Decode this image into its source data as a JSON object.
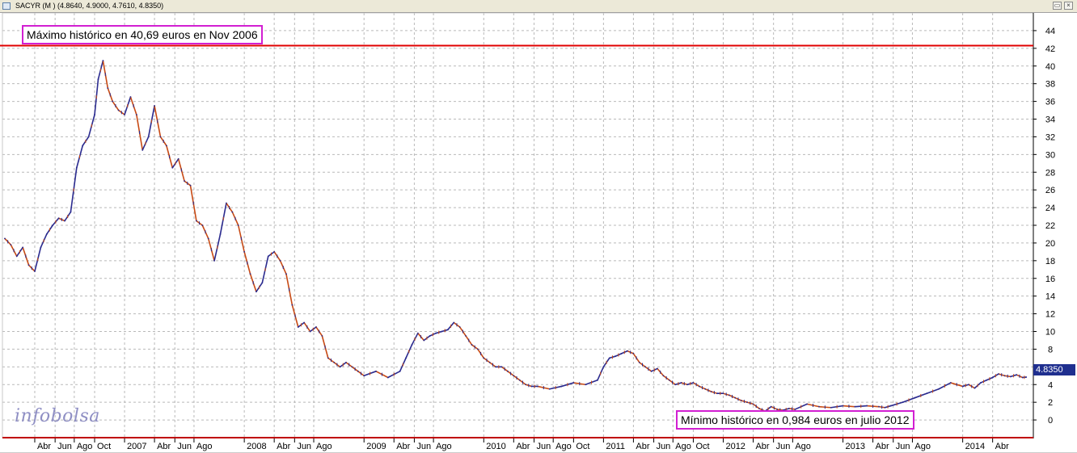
{
  "window": {
    "title": "SACYR (M ) (4.8640, 4.9000, 4.7610, 4.8350)"
  },
  "annotations": {
    "max_label": "Máximo histórico en 40,69 euros en Nov 2006",
    "min_label": "Mínimo histórico en 0,984 euros en julio 2012"
  },
  "logo": {
    "text_part1": "info",
    "text_part2": "bolsa"
  },
  "last_price": "4.8350",
  "colors": {
    "up": "#2b2b8f",
    "down": "#c84a14",
    "resistance": "#e00000",
    "annotation_border": "#d21fd2",
    "grid": "#b9b9b9"
  },
  "chart_data": {
    "type": "line",
    "ylim": [
      -2,
      46
    ],
    "yticks": [
      0,
      2,
      4,
      6,
      8,
      10,
      12,
      14,
      16,
      18,
      20,
      22,
      24,
      26,
      28,
      30,
      32,
      34,
      36,
      38,
      40,
      42,
      44
    ],
    "grid": true,
    "resistance_level": 42.3,
    "x_range": [
      2005.98,
      2014.59
    ],
    "x_ticks": [
      {
        "t": 2006.25,
        "label": "Abr"
      },
      {
        "t": 2006.42,
        "label": "Jun"
      },
      {
        "t": 2006.58,
        "label": "Ago"
      },
      {
        "t": 2006.75,
        "label": "Oct"
      },
      {
        "t": 2007.0,
        "label": "2007"
      },
      {
        "t": 2007.25,
        "label": "Abr"
      },
      {
        "t": 2007.42,
        "label": "Jun"
      },
      {
        "t": 2007.58,
        "label": "Ago"
      },
      {
        "t": 2008.0,
        "label": "2008"
      },
      {
        "t": 2008.25,
        "label": "Abr"
      },
      {
        "t": 2008.42,
        "label": "Jun"
      },
      {
        "t": 2008.58,
        "label": "Ago"
      },
      {
        "t": 2009.0,
        "label": "2009"
      },
      {
        "t": 2009.25,
        "label": "Abr"
      },
      {
        "t": 2009.42,
        "label": "Jun"
      },
      {
        "t": 2009.58,
        "label": "Ago"
      },
      {
        "t": 2010.0,
        "label": "2010"
      },
      {
        "t": 2010.25,
        "label": "Abr"
      },
      {
        "t": 2010.42,
        "label": "Jun"
      },
      {
        "t": 2010.58,
        "label": "Ago"
      },
      {
        "t": 2010.75,
        "label": "Oct"
      },
      {
        "t": 2011.0,
        "label": "2011"
      },
      {
        "t": 2011.25,
        "label": "Abr"
      },
      {
        "t": 2011.42,
        "label": "Jun"
      },
      {
        "t": 2011.58,
        "label": "Ago"
      },
      {
        "t": 2011.75,
        "label": "Oct"
      },
      {
        "t": 2012.0,
        "label": "2012"
      },
      {
        "t": 2012.25,
        "label": "Abr"
      },
      {
        "t": 2012.42,
        "label": "Jun"
      },
      {
        "t": 2012.58,
        "label": "Ago"
      },
      {
        "t": 2013.0,
        "label": "2013"
      },
      {
        "t": 2013.25,
        "label": "Abr"
      },
      {
        "t": 2013.42,
        "label": "Jun"
      },
      {
        "t": 2013.58,
        "label": "Ago"
      },
      {
        "t": 2014.0,
        "label": "2014"
      },
      {
        "t": 2014.25,
        "label": "Abr"
      }
    ],
    "series": [
      {
        "values": [
          {
            "t": 2006.0,
            "v": 20.5
          },
          {
            "t": 2006.05,
            "v": 19.8
          },
          {
            "t": 2006.1,
            "v": 18.5
          },
          {
            "t": 2006.15,
            "v": 19.5
          },
          {
            "t": 2006.2,
            "v": 17.5
          },
          {
            "t": 2006.25,
            "v": 16.8
          },
          {
            "t": 2006.3,
            "v": 19.5
          },
          {
            "t": 2006.35,
            "v": 21.0
          },
          {
            "t": 2006.4,
            "v": 22.0
          },
          {
            "t": 2006.45,
            "v": 22.8
          },
          {
            "t": 2006.5,
            "v": 22.5
          },
          {
            "t": 2006.55,
            "v": 23.5
          },
          {
            "t": 2006.6,
            "v": 28.5
          },
          {
            "t": 2006.65,
            "v": 31.0
          },
          {
            "t": 2006.7,
            "v": 32.0
          },
          {
            "t": 2006.75,
            "v": 34.5
          },
          {
            "t": 2006.78,
            "v": 38.5
          },
          {
            "t": 2006.82,
            "v": 40.6
          },
          {
            "t": 2006.86,
            "v": 37.5
          },
          {
            "t": 2006.9,
            "v": 36.0
          },
          {
            "t": 2006.95,
            "v": 35.0
          },
          {
            "t": 2007.0,
            "v": 34.5
          },
          {
            "t": 2007.05,
            "v": 36.5
          },
          {
            "t": 2007.1,
            "v": 34.5
          },
          {
            "t": 2007.15,
            "v": 30.5
          },
          {
            "t": 2007.2,
            "v": 32.0
          },
          {
            "t": 2007.25,
            "v": 35.5
          },
          {
            "t": 2007.3,
            "v": 32.0
          },
          {
            "t": 2007.35,
            "v": 31.0
          },
          {
            "t": 2007.4,
            "v": 28.5
          },
          {
            "t": 2007.45,
            "v": 29.5
          },
          {
            "t": 2007.5,
            "v": 27.0
          },
          {
            "t": 2007.55,
            "v": 26.5
          },
          {
            "t": 2007.6,
            "v": 22.5
          },
          {
            "t": 2007.65,
            "v": 22.0
          },
          {
            "t": 2007.7,
            "v": 20.5
          },
          {
            "t": 2007.75,
            "v": 18.0
          },
          {
            "t": 2007.8,
            "v": 21.0
          },
          {
            "t": 2007.85,
            "v": 24.5
          },
          {
            "t": 2007.9,
            "v": 23.5
          },
          {
            "t": 2007.95,
            "v": 22.0
          },
          {
            "t": 2008.0,
            "v": 19.0
          },
          {
            "t": 2008.05,
            "v": 16.5
          },
          {
            "t": 2008.1,
            "v": 14.5
          },
          {
            "t": 2008.15,
            "v": 15.5
          },
          {
            "t": 2008.2,
            "v": 18.5
          },
          {
            "t": 2008.25,
            "v": 19.0
          },
          {
            "t": 2008.3,
            "v": 18.0
          },
          {
            "t": 2008.35,
            "v": 16.5
          },
          {
            "t": 2008.4,
            "v": 13.0
          },
          {
            "t": 2008.45,
            "v": 10.5
          },
          {
            "t": 2008.5,
            "v": 11.0
          },
          {
            "t": 2008.55,
            "v": 10.0
          },
          {
            "t": 2008.6,
            "v": 10.5
          },
          {
            "t": 2008.65,
            "v": 9.5
          },
          {
            "t": 2008.7,
            "v": 7.0
          },
          {
            "t": 2008.75,
            "v": 6.5
          },
          {
            "t": 2008.8,
            "v": 6.0
          },
          {
            "t": 2008.85,
            "v": 6.5
          },
          {
            "t": 2008.9,
            "v": 6.0
          },
          {
            "t": 2008.95,
            "v": 5.5
          },
          {
            "t": 2009.0,
            "v": 5.0
          },
          {
            "t": 2009.1,
            "v": 5.5
          },
          {
            "t": 2009.2,
            "v": 4.8
          },
          {
            "t": 2009.3,
            "v": 5.5
          },
          {
            "t": 2009.35,
            "v": 7.0
          },
          {
            "t": 2009.4,
            "v": 8.5
          },
          {
            "t": 2009.45,
            "v": 9.8
          },
          {
            "t": 2009.5,
            "v": 9.0
          },
          {
            "t": 2009.55,
            "v": 9.5
          },
          {
            "t": 2009.6,
            "v": 9.8
          },
          {
            "t": 2009.65,
            "v": 10.0
          },
          {
            "t": 2009.7,
            "v": 10.2
          },
          {
            "t": 2009.75,
            "v": 11.0
          },
          {
            "t": 2009.8,
            "v": 10.5
          },
          {
            "t": 2009.85,
            "v": 9.5
          },
          {
            "t": 2009.9,
            "v": 8.5
          },
          {
            "t": 2009.95,
            "v": 8.0
          },
          {
            "t": 2010.0,
            "v": 7.0
          },
          {
            "t": 2010.05,
            "v": 6.5
          },
          {
            "t": 2010.1,
            "v": 6.0
          },
          {
            "t": 2010.15,
            "v": 6.0
          },
          {
            "t": 2010.2,
            "v": 5.5
          },
          {
            "t": 2010.25,
            "v": 5.0
          },
          {
            "t": 2010.3,
            "v": 4.5
          },
          {
            "t": 2010.35,
            "v": 4.0
          },
          {
            "t": 2010.4,
            "v": 3.8
          },
          {
            "t": 2010.45,
            "v": 3.8
          },
          {
            "t": 2010.55,
            "v": 3.5
          },
          {
            "t": 2010.65,
            "v": 3.8
          },
          {
            "t": 2010.75,
            "v": 4.2
          },
          {
            "t": 2010.85,
            "v": 4.0
          },
          {
            "t": 2010.95,
            "v": 4.5
          },
          {
            "t": 2011.0,
            "v": 6.0
          },
          {
            "t": 2011.05,
            "v": 7.0
          },
          {
            "t": 2011.1,
            "v": 7.2
          },
          {
            "t": 2011.15,
            "v": 7.5
          },
          {
            "t": 2011.2,
            "v": 7.8
          },
          {
            "t": 2011.25,
            "v": 7.5
          },
          {
            "t": 2011.3,
            "v": 6.5
          },
          {
            "t": 2011.35,
            "v": 6.0
          },
          {
            "t": 2011.4,
            "v": 5.5
          },
          {
            "t": 2011.45,
            "v": 5.8
          },
          {
            "t": 2011.5,
            "v": 5.0
          },
          {
            "t": 2011.55,
            "v": 4.5
          },
          {
            "t": 2011.6,
            "v": 4.0
          },
          {
            "t": 2011.65,
            "v": 4.2
          },
          {
            "t": 2011.7,
            "v": 4.0
          },
          {
            "t": 2011.75,
            "v": 4.2
          },
          {
            "t": 2011.8,
            "v": 3.8
          },
          {
            "t": 2011.85,
            "v": 3.5
          },
          {
            "t": 2011.9,
            "v": 3.2
          },
          {
            "t": 2011.95,
            "v": 3.0
          },
          {
            "t": 2012.0,
            "v": 3.0
          },
          {
            "t": 2012.05,
            "v": 2.8
          },
          {
            "t": 2012.1,
            "v": 2.5
          },
          {
            "t": 2012.15,
            "v": 2.2
          },
          {
            "t": 2012.2,
            "v": 2.0
          },
          {
            "t": 2012.25,
            "v": 1.8
          },
          {
            "t": 2012.3,
            "v": 1.3
          },
          {
            "t": 2012.35,
            "v": 1.0
          },
          {
            "t": 2012.4,
            "v": 1.5
          },
          {
            "t": 2012.45,
            "v": 1.2
          },
          {
            "t": 2012.5,
            "v": 1.1
          },
          {
            "t": 2012.55,
            "v": 1.3
          },
          {
            "t": 2012.6,
            "v": 1.2
          },
          {
            "t": 2012.7,
            "v": 1.8
          },
          {
            "t": 2012.8,
            "v": 1.5
          },
          {
            "t": 2012.9,
            "v": 1.4
          },
          {
            "t": 2013.0,
            "v": 1.6
          },
          {
            "t": 2013.1,
            "v": 1.5
          },
          {
            "t": 2013.2,
            "v": 1.6
          },
          {
            "t": 2013.3,
            "v": 1.5
          },
          {
            "t": 2013.35,
            "v": 1.4
          },
          {
            "t": 2013.4,
            "v": 1.6
          },
          {
            "t": 2013.5,
            "v": 2.0
          },
          {
            "t": 2013.6,
            "v": 2.5
          },
          {
            "t": 2013.7,
            "v": 3.0
          },
          {
            "t": 2013.8,
            "v": 3.5
          },
          {
            "t": 2013.9,
            "v": 4.2
          },
          {
            "t": 2014.0,
            "v": 3.8
          },
          {
            "t": 2014.05,
            "v": 4.0
          },
          {
            "t": 2014.1,
            "v": 3.6
          },
          {
            "t": 2014.15,
            "v": 4.2
          },
          {
            "t": 2014.2,
            "v": 4.5
          },
          {
            "t": 2014.25,
            "v": 4.8
          },
          {
            "t": 2014.3,
            "v": 5.2
          },
          {
            "t": 2014.35,
            "v": 5.0
          },
          {
            "t": 2014.4,
            "v": 4.9
          },
          {
            "t": 2014.45,
            "v": 5.1
          },
          {
            "t": 2014.5,
            "v": 4.8
          },
          {
            "t": 2014.53,
            "v": 4.84
          }
        ]
      }
    ]
  }
}
